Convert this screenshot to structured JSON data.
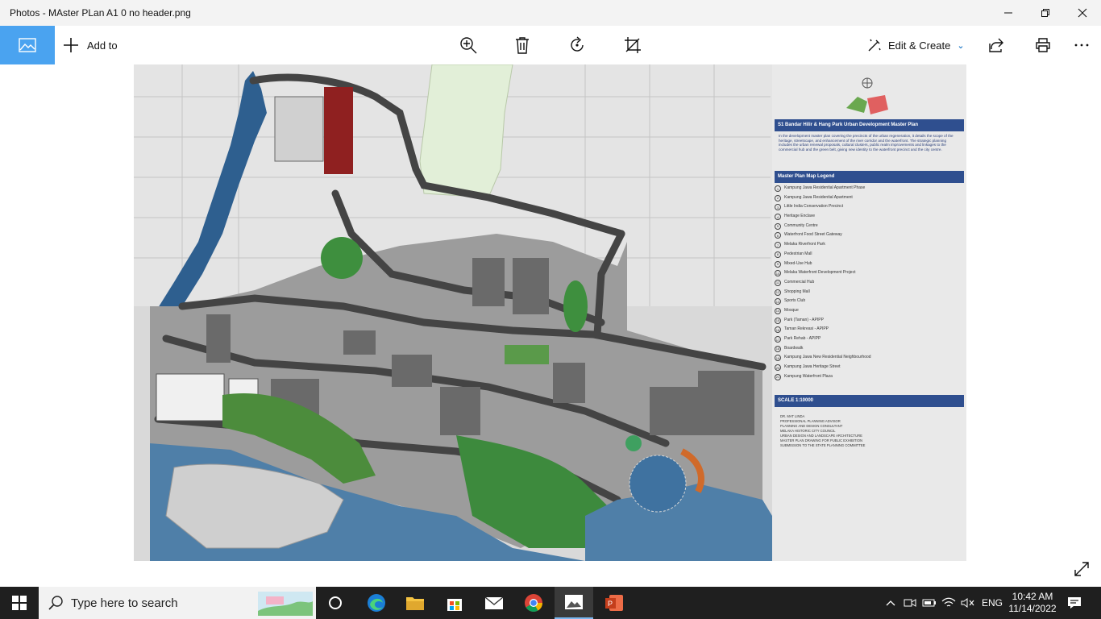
{
  "window": {
    "title": "Photos - MAster PLan A1 0 no header.png",
    "controls": {
      "minimize_icon": "minimize-icon",
      "maximize_icon": "restore-icon",
      "close_icon": "close-icon"
    }
  },
  "toolbar": {
    "add_to_label": "Add to",
    "edit_create_label": "Edit & Create",
    "accent_color": "#4aa3f0",
    "tools": [
      "zoom-in-icon",
      "delete-icon",
      "rotate-icon",
      "crop-icon",
      "share-icon",
      "print-icon",
      "more-icon"
    ]
  },
  "map": {
    "panel_title": "S1 Bandar Hilir & Hang Park Urban Development Master Plan",
    "legend_title": "Master Plan Map Legend",
    "scale_title": "SCALE 1:10000",
    "description": "In the development master plan covering the precincts of the urban regeneration, it details the scope of the heritage, streetscape, and enhancement of the river corridor and the waterfront. The strategic planning includes the urban renewal proposals, cultural clusters, public realm improvements and linkages to the commercial hub and the green belt, giving new identity to the waterfront precinct and the city centre.",
    "legend_items": [
      "Kampung Jawa Residential Apartment Phase",
      "Kampung Jawa Residential Apartment",
      "Little India Conservation Precinct",
      "Heritage Enclave",
      "Community Centre",
      "Waterfront Food Street Gateway",
      "Melaka Riverfront Park",
      "Pedestrian Mall",
      "Mixed-Use Hub",
      "Melaka Waterfront Development Project",
      "Commercial Hub",
      "Shopping Mall",
      "Sports Club",
      "Mosque",
      "Park (Taman) - APIPP",
      "Taman Rekreasi - APIPP",
      "Park Rehab - APIPP",
      "Boardwalk",
      "Kampung Jawa New Residential Neighbourhood",
      "Kampung Jawa Heritage Street",
      "Kampung Waterfront Plaza"
    ],
    "scale_lines": [
      "DR. MAT LINDA",
      "PROFESSIONAL PLANNING ADVISOR",
      "PLANNING AND DESIGN CONSULTANT",
      "MELAKA HISTORIC CITY COUNCIL",
      "URBAN DESIGN AND LANDSCAPE ARCHITECTURE",
      "MASTER PLAN DRAWING FOR PUBLIC EXHIBITION",
      "SUBMISSION TO THE STATE PLANNING COMMITTEE"
    ],
    "colors": {
      "water": "#4f7fa8",
      "roads": "#4a4a4a",
      "park": "#3e8f3e",
      "heritage": "#8f2020",
      "panel_header": "#2f4f8f"
    }
  },
  "taskbar": {
    "search_placeholder": "Type here to search",
    "apps": [
      "cortana-icon",
      "edge-icon",
      "file-explorer-icon",
      "store-icon",
      "mail-icon",
      "chrome-icon",
      "photos-icon",
      "powerpoint-icon"
    ],
    "language": "ENG",
    "time": "10:42 AM",
    "date": "11/14/2022"
  }
}
